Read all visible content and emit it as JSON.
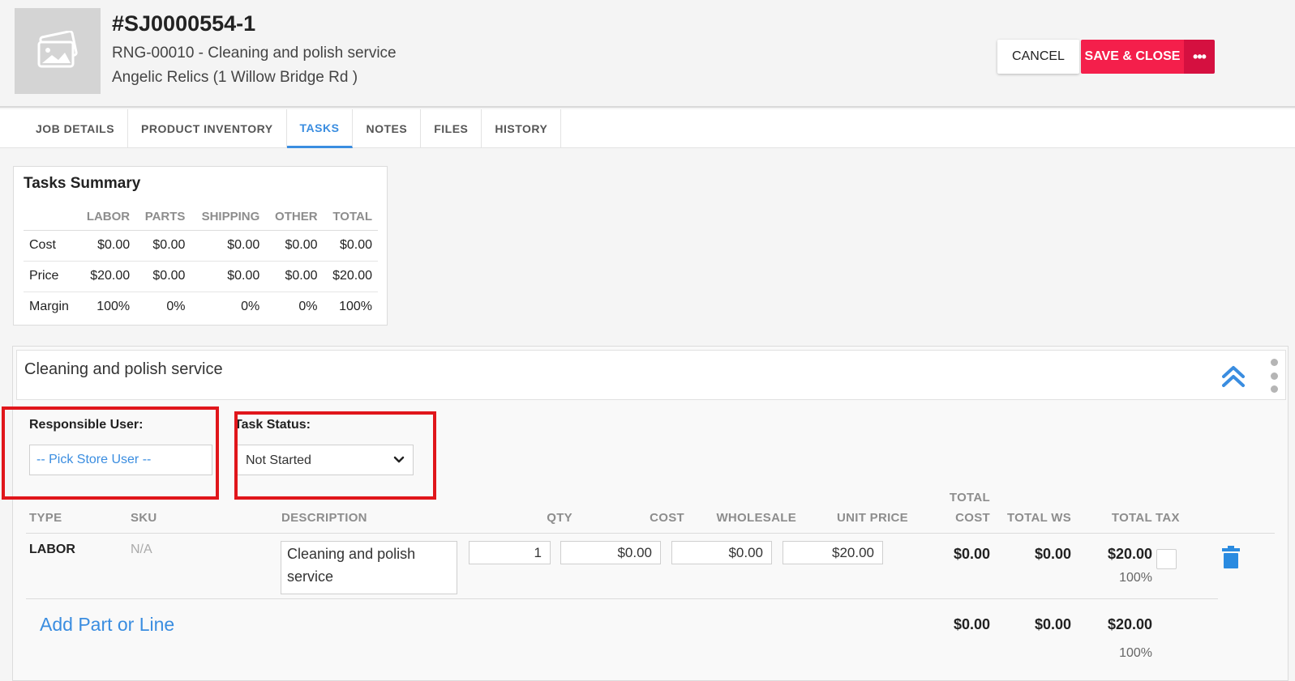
{
  "header": {
    "job_number": "#SJ0000554-1",
    "subtitle": "RNG-00010 - Cleaning and polish service",
    "customer": "Angelic Relics (1 Willow Bridge Rd )",
    "cancel_label": "CANCEL",
    "save_label": "SAVE & CLOSE",
    "more_label": "•••"
  },
  "tabs": [
    "JOB DETAILS",
    "PRODUCT INVENTORY",
    "TASKS",
    "NOTES",
    "FILES",
    "HISTORY"
  ],
  "summary": {
    "title": "Tasks Summary",
    "columns": [
      "LABOR",
      "PARTS",
      "SHIPPING",
      "OTHER",
      "TOTAL"
    ],
    "rows": [
      {
        "label": "Cost",
        "values": [
          "$0.00",
          "$0.00",
          "$0.00",
          "$0.00",
          "$0.00"
        ]
      },
      {
        "label": "Price",
        "values": [
          "$20.00",
          "$0.00",
          "$0.00",
          "$0.00",
          "$20.00"
        ]
      },
      {
        "label": "Margin",
        "values": [
          "100%",
          "0%",
          "0%",
          "0%",
          "100%"
        ]
      }
    ]
  },
  "task": {
    "name": "Cleaning and polish service",
    "responsible_label": "Responsible User:",
    "responsible_placeholder": "-- Pick Store User --",
    "status_label": "Task Status:",
    "status_value": "Not Started",
    "columns": {
      "type": "TYPE",
      "sku": "SKU",
      "description": "DESCRIPTION",
      "qty": "QTY",
      "cost": "COST",
      "wholesale": "WHOLESALE",
      "unit_price": "UNIT PRICE",
      "total_cost_1": "TOTAL",
      "total_cost_2": "COST",
      "total_ws": "TOTAL WS",
      "total": "TOTAL",
      "tax": "TAX"
    },
    "line": {
      "type": "LABOR",
      "sku": "N/A",
      "description": "Cleaning and polish service",
      "qty": "1",
      "cost": "$0.00",
      "wholesale": "$0.00",
      "unit_price": "$20.00",
      "total_cost": "$0.00",
      "total_ws": "$0.00",
      "total": "$20.00",
      "margin": "100%"
    },
    "add_link": "Add Part or Line",
    "footer": {
      "total_cost": "$0.00",
      "total_ws": "$0.00",
      "total": "$20.00",
      "margin": "100%"
    }
  },
  "colors": {
    "accent": "#3a8de0",
    "save_button": "#f41f4b",
    "highlight_border": "#e0161b"
  }
}
